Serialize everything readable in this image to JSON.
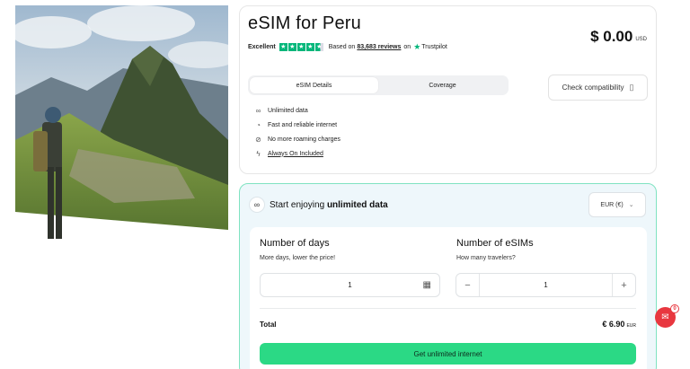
{
  "hero": {
    "alt_icon": "machu-picchu-photo"
  },
  "product": {
    "title": "eSIM for Peru",
    "price": "$ 0.00",
    "price_currency": "USD",
    "rating": {
      "label": "Excellent",
      "stars": 4.5,
      "based_on": "Based on",
      "reviews": "83,683 reviews",
      "on": "on",
      "provider": "Trustpilot"
    },
    "tabs": [
      {
        "label": "eSIM Details",
        "active": true
      },
      {
        "label": "Coverage",
        "active": false
      }
    ],
    "check_compatibility": "Check compatibility",
    "features": [
      {
        "icon": "infinity-icon",
        "label": "Unlimited data"
      },
      {
        "icon": "speedometer-icon",
        "label": "Fast and reliable internet"
      },
      {
        "icon": "no-roaming-icon",
        "label": "No more roaming charges"
      },
      {
        "icon": "bolt-icon",
        "label": "Always On Included"
      }
    ]
  },
  "purchase": {
    "heading_prefix": "Start enjoying",
    "heading_bold": "unlimited data",
    "currency_select": "EUR (€)",
    "days": {
      "title": "Number of days",
      "subtitle": "More days, lower the price!",
      "value": "1"
    },
    "sims": {
      "title": "Number of eSIMs",
      "subtitle": "How many travelers?",
      "value": "1"
    },
    "total_label": "Total",
    "total_value": "€ 6.90",
    "total_currency": "EUR",
    "cta": "Get unlimited internet"
  },
  "chat": {
    "badge": "0"
  },
  "colors": {
    "accent": "#2bd985",
    "border_accent": "#7fe3c1",
    "trustpilot": "#00b67a",
    "chat": "#e8373f"
  }
}
